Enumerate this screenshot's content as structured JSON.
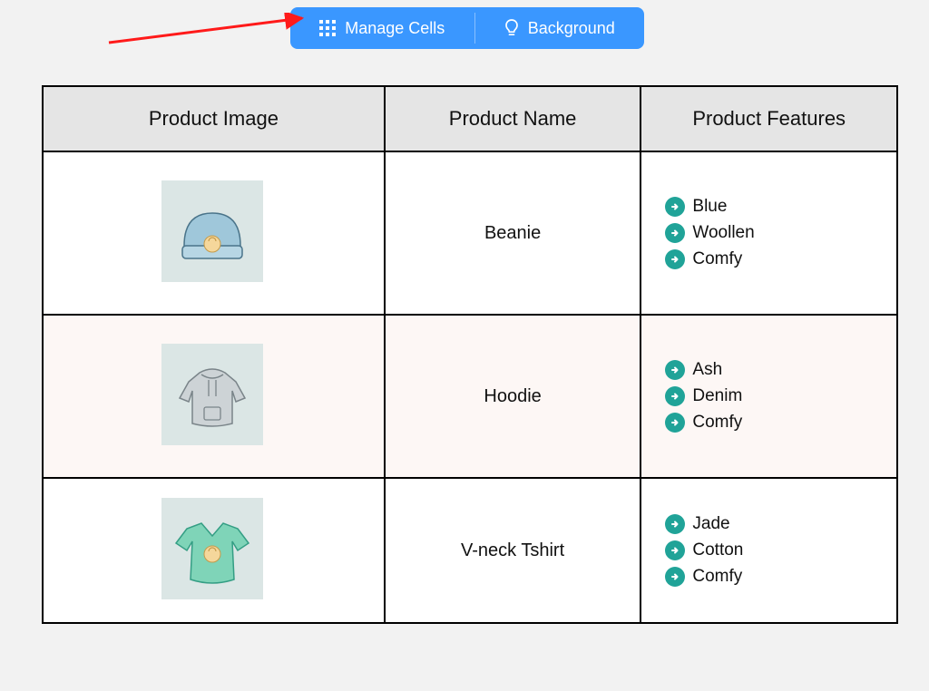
{
  "toolbar": {
    "manage_label": "Manage Cells",
    "background_label": "Background"
  },
  "table": {
    "headers": {
      "image": "Product Image",
      "name": "Product Name",
      "features": "Product Features"
    },
    "rows": [
      {
        "image": "beanie",
        "name": "Beanie",
        "features": [
          "Blue",
          "Woollen",
          "Comfy"
        ]
      },
      {
        "image": "hoodie",
        "name": "Hoodie",
        "features": [
          "Ash",
          "Denim",
          "Comfy"
        ]
      },
      {
        "image": "vneck",
        "name": "V-neck Tshirt",
        "features": [
          "Jade",
          "Cotton",
          "Comfy"
        ]
      }
    ]
  },
  "colors": {
    "accent": "#3a97ff",
    "bullet": "#20a398",
    "header_bg": "#e5e5e5",
    "alt_row": "#fdf7f5"
  }
}
